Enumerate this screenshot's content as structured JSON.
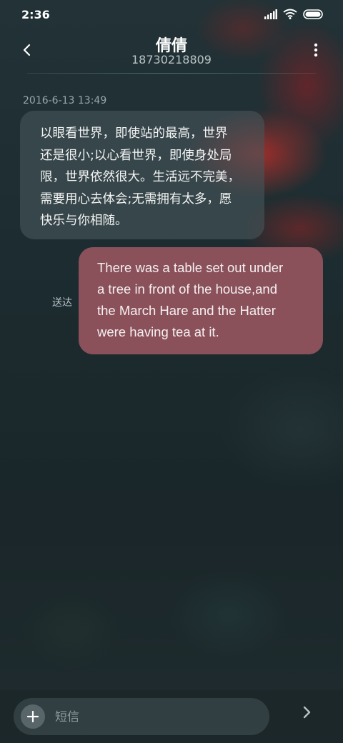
{
  "status_bar": {
    "time": "2:36",
    "icons": [
      "signal-icon",
      "wifi-icon",
      "battery-icon"
    ]
  },
  "header": {
    "contact_name": "倩倩",
    "contact_number": "18730218809",
    "back_icon": "chevron-left-icon",
    "more_icon": "more-vertical-icon"
  },
  "conversation": {
    "timestamp": "2016-6-13 13:49",
    "messages": [
      {
        "direction": "incoming",
        "text": "以眼看世界，即使站的最高，世界\n还是很小;以心看世界，即使身处局\n限，世界依然很大。生活远不完美，\n需要用心去体会;无需拥有太多，愿\n快乐与你相随。"
      },
      {
        "direction": "outgoing",
        "text": "There was a table set out under\na tree in front of the house,and\nthe March Hare and the Hatter\nwere having tea at it.",
        "status": "送达"
      }
    ]
  },
  "composer": {
    "placeholder": "短信",
    "value": "",
    "add_icon": "plus-icon",
    "send_icon": "send-chevron-icon"
  },
  "colors": {
    "outgoing_bubble": "#8a515b",
    "incoming_bubble": "#46555a",
    "background": "#1c2b2f"
  }
}
